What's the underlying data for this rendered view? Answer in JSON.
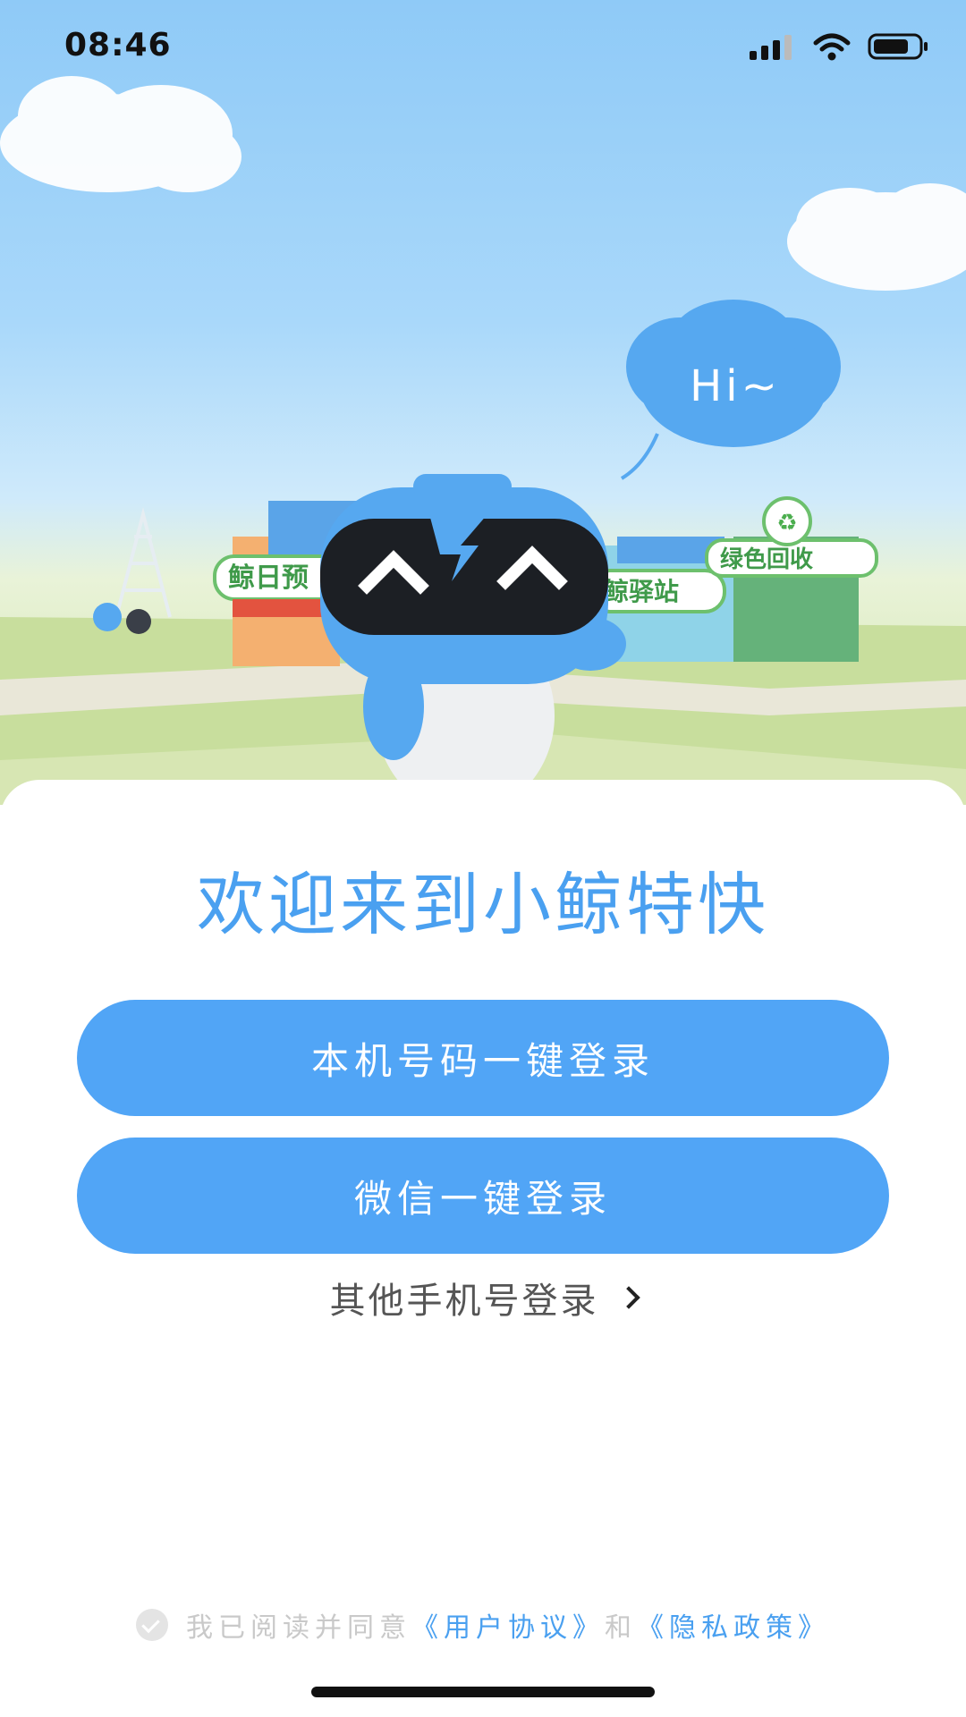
{
  "status_bar": {
    "time": "08:46"
  },
  "hero": {
    "speech_bubble": "Hi~",
    "sign_left": "鲸日预",
    "sign_middle": "鲸驿站",
    "sign_right": "绿色回收"
  },
  "welcome": {
    "title": "欢迎来到小鲸特快"
  },
  "buttons": {
    "phone_login": "本机号码一键登录",
    "wechat_login": "微信一键登录",
    "other_login": "其他手机号登录"
  },
  "agreement": {
    "prefix": "我已阅读并同意",
    "user_agreement": "《用户协议》",
    "and": "和",
    "privacy_policy": "《隐私政策》"
  },
  "colors": {
    "accent": "#51a5f6",
    "title": "#4aa0f0"
  },
  "icons": [
    "signal-icon",
    "wifi-icon",
    "battery-icon",
    "check-icon",
    "chevron-right-icon"
  ]
}
